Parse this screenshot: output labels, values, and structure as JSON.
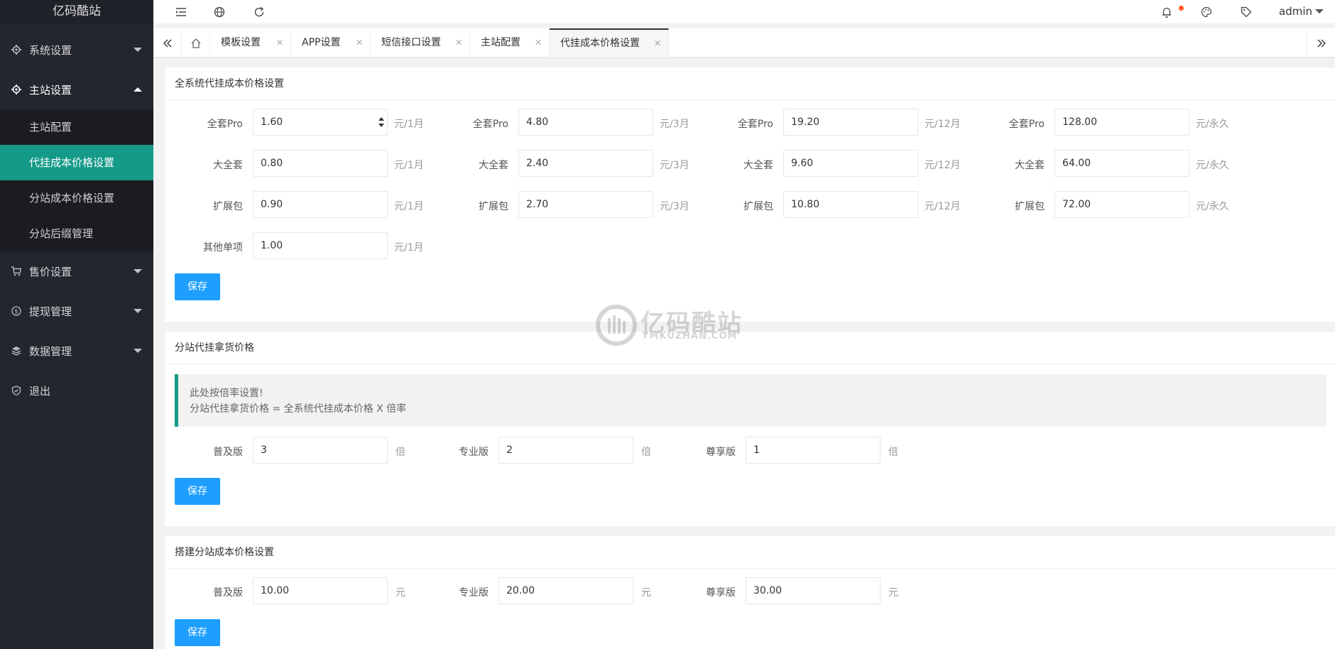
{
  "app": {
    "logo": "亿码酷站"
  },
  "header": {
    "user": "admin"
  },
  "sidebar": {
    "items": [
      {
        "label": "系统设置"
      },
      {
        "label": "主站设置"
      },
      {
        "label": "售价设置"
      },
      {
        "label": "提现管理"
      },
      {
        "label": "数据管理"
      },
      {
        "label": "退出"
      }
    ],
    "sub_items": [
      {
        "label": "主站配置"
      },
      {
        "label": "代挂成本价格设置"
      },
      {
        "label": "分站成本价格设置"
      },
      {
        "label": "分站后缀管理"
      }
    ]
  },
  "tabs": [
    {
      "label": "模板设置"
    },
    {
      "label": "APP设置"
    },
    {
      "label": "短信接口设置"
    },
    {
      "label": "主站配置"
    },
    {
      "label": "代挂成本价格设置"
    }
  ],
  "section1": {
    "title": "全系统代挂成本价格设置",
    "rows": [
      {
        "label": "全套Pro",
        "cells": [
          {
            "value": "1.60",
            "unit": "元/1月"
          },
          {
            "value": "4.80",
            "unit": "元/3月"
          },
          {
            "value": "19.20",
            "unit": "元/12月"
          },
          {
            "value": "128.00",
            "unit": "元/永久"
          }
        ]
      },
      {
        "label": "大全套",
        "cells": [
          {
            "value": "0.80",
            "unit": "元/1月"
          },
          {
            "value": "2.40",
            "unit": "元/3月"
          },
          {
            "value": "9.60",
            "unit": "元/12月"
          },
          {
            "value": "64.00",
            "unit": "元/永久"
          }
        ]
      },
      {
        "label": "扩展包",
        "cells": [
          {
            "value": "0.90",
            "unit": "元/1月"
          },
          {
            "value": "2.70",
            "unit": "元/3月"
          },
          {
            "value": "10.80",
            "unit": "元/12月"
          },
          {
            "value": "72.00",
            "unit": "元/永久"
          }
        ]
      },
      {
        "label": "其他单项",
        "cells": [
          {
            "value": "1.00",
            "unit": "元/1月"
          }
        ]
      }
    ],
    "save": "保存"
  },
  "section2": {
    "title": "分站代挂拿货价格",
    "note_line1": "此处按倍率设置!",
    "note_line2": "分站代挂拿货价格 = 全系统代挂成本价格 X 倍率",
    "fields": [
      {
        "label": "普及版",
        "value": "3",
        "unit": "倍"
      },
      {
        "label": "专业版",
        "value": "2",
        "unit": "倍"
      },
      {
        "label": "尊享版",
        "value": "1",
        "unit": "倍"
      }
    ],
    "save": "保存"
  },
  "section3": {
    "title": "搭建分站成本价格设置",
    "fields": [
      {
        "label": "普及版",
        "value": "10.00",
        "unit": "元"
      },
      {
        "label": "专业版",
        "value": "20.00",
        "unit": "元"
      },
      {
        "label": "尊享版",
        "value": "30.00",
        "unit": "元"
      }
    ],
    "save": "保存"
  },
  "watermark": {
    "text": "亿码酷站",
    "sub": "YMKUZHAN.COM"
  },
  "colors": {
    "sidebar": "#23262e",
    "active": "#159a88",
    "button": "#1e9fff",
    "dot": "#ff5722"
  }
}
